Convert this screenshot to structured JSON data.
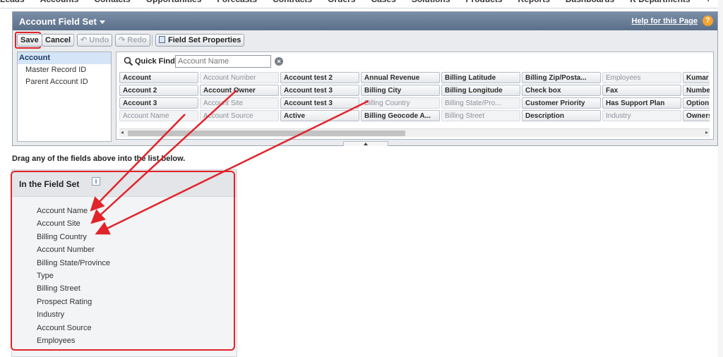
{
  "topnav": {
    "tabs": [
      "Leads",
      "Accounts",
      "Contacts",
      "Opportunities",
      "Forecasts",
      "Contracts",
      "Orders",
      "Cases",
      "Solutions",
      "Products",
      "Reports",
      "Dashboards",
      "K Departments",
      "+"
    ]
  },
  "header": {
    "title": "Account Field Set",
    "help_link": "Help for this Page",
    "help_icon": "?"
  },
  "toolbar": {
    "save": "Save",
    "cancel": "Cancel",
    "undo": "Undo",
    "redo": "Redo",
    "properties": "Field Set Properties"
  },
  "objects": [
    "Account",
    "Master Record ID",
    "Parent Account ID"
  ],
  "quick_find": {
    "label": "Quick Find",
    "placeholder": "Account Name",
    "clear": "×"
  },
  "fields": [
    {
      "label": "Account",
      "used": false
    },
    {
      "label": "Account Number",
      "used": true
    },
    {
      "label": "Account test 2",
      "used": false
    },
    {
      "label": "Annual Revenue",
      "used": false
    },
    {
      "label": "Billing Latitude",
      "used": false
    },
    {
      "label": "Billing Zip/Posta...",
      "used": false
    },
    {
      "label": "Employees",
      "used": true
    },
    {
      "label": "Kumar",
      "used": false
    },
    {
      "label": "Account 2",
      "used": false
    },
    {
      "label": "Account Owner",
      "used": false
    },
    {
      "label": "Account test 3",
      "used": false
    },
    {
      "label": "Billing City",
      "used": false
    },
    {
      "label": "Billing Longitude",
      "used": false
    },
    {
      "label": "Check box",
      "used": false
    },
    {
      "label": "Fax",
      "used": false
    },
    {
      "label": "Number",
      "used": false
    },
    {
      "label": "Account 3",
      "used": false
    },
    {
      "label": "Account Site",
      "used": true
    },
    {
      "label": "Account test 3",
      "used": false
    },
    {
      "label": "Billing Country",
      "used": true
    },
    {
      "label": "Billing State/Pro...",
      "used": true
    },
    {
      "label": "Customer Priority",
      "used": false
    },
    {
      "label": "Has Support Plan",
      "used": false
    },
    {
      "label": "Option",
      "used": false
    },
    {
      "label": "Account Name",
      "used": true
    },
    {
      "label": "Account Source",
      "used": true
    },
    {
      "label": "Active",
      "used": false
    },
    {
      "label": "Billing Geocode A...",
      "used": false
    },
    {
      "label": "Billing Street",
      "used": true
    },
    {
      "label": "Description",
      "used": false
    },
    {
      "label": "Industry",
      "used": true
    },
    {
      "label": "Ownership",
      "used": false
    }
  ],
  "instruction": "Drag any of the fields above into the list below.",
  "field_set": {
    "title": "In the Field Set",
    "info_icon": "i",
    "items": [
      "Account Name",
      "Account Site",
      "Billing Country",
      "Account Number",
      "Billing State/Province",
      "Type",
      "Billing Street",
      "Prospect Rating",
      "Industry",
      "Account Source",
      "Employees"
    ]
  },
  "colors": {
    "highlight": "#e0242a",
    "header": "#6a7f99"
  }
}
